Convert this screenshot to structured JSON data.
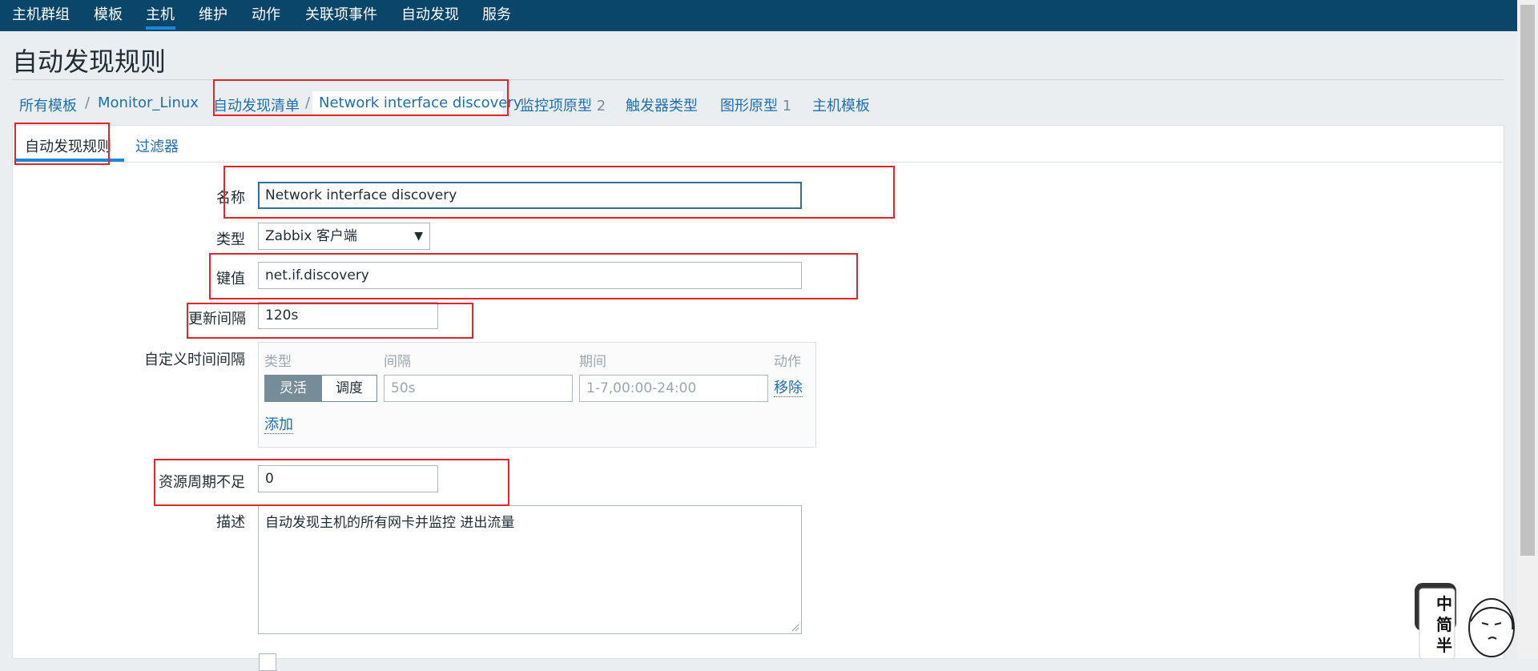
{
  "nav": {
    "items": [
      "主机群组",
      "模板",
      "主机",
      "维护",
      "动作",
      "关联项事件",
      "自动发现",
      "服务"
    ],
    "active_index": 2
  },
  "page": {
    "title": "自动发现规则"
  },
  "breadcrumb": {
    "all_templates": "所有模板",
    "template": "Monitor_Linux",
    "discovery_list": "自动发现清单",
    "current": "Network interface discovery",
    "separator": "/",
    "item_prototypes": {
      "label": "监控项原型",
      "count": "2"
    },
    "trigger_types": "触发器类型",
    "graph_prototypes": {
      "label": "图形原型",
      "count": "1"
    },
    "host_templates": "主机模板"
  },
  "tabs": {
    "discovery_rule": "自动发现规则",
    "filters": "过滤器"
  },
  "form": {
    "name": {
      "label": "名称",
      "value": "Network interface discovery"
    },
    "type": {
      "label": "类型",
      "value": "Zabbix 客户端"
    },
    "key": {
      "label": "键值",
      "value": "net.if.discovery"
    },
    "update_interval": {
      "label": "更新间隔",
      "value": "120s"
    },
    "custom_intervals": {
      "label": "自定义时间间隔",
      "headers": {
        "type": "类型",
        "interval": "间隔",
        "period": "期间",
        "action": "动作"
      },
      "row": {
        "flexible": "灵活",
        "scheduling": "调度",
        "interval_placeholder": "50s",
        "period_placeholder": "1-7,00:00-24:00",
        "remove": "移除"
      },
      "add": "添加"
    },
    "keep_lost": {
      "label": "资源周期不足",
      "value": "0"
    },
    "description": {
      "label": "描述",
      "value": "自动发现主机的所有网卡并监控 进出流量"
    }
  },
  "sticker": {
    "chars": [
      "中",
      "简",
      "半"
    ]
  },
  "colors": {
    "nav_bg": "#0a466a",
    "link": "#1f6fb0",
    "annotation": "#e0262b"
  }
}
